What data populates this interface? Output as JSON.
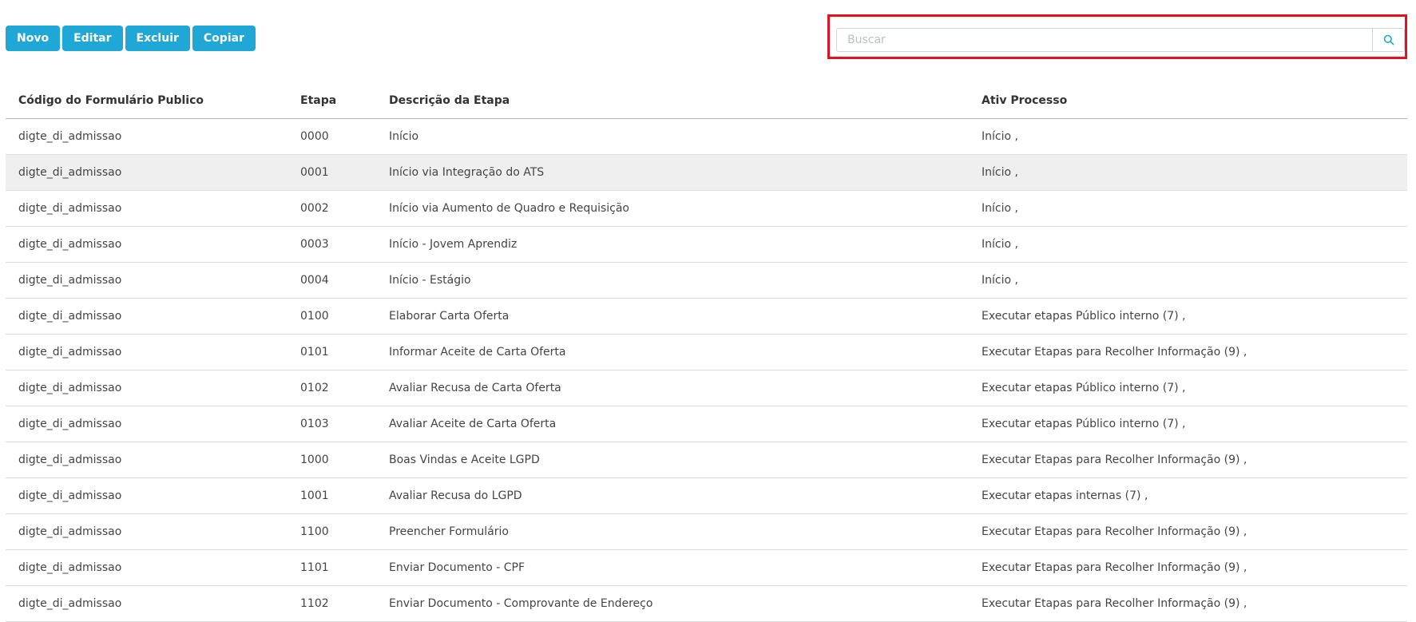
{
  "toolbar": {
    "new_label": "Novo",
    "edit_label": "Editar",
    "delete_label": "Excluir",
    "copy_label": "Copiar"
  },
  "search": {
    "placeholder": "Buscar",
    "value": "",
    "icon": "search-icon"
  },
  "colors": {
    "accent": "#1fa7d6",
    "highlight_box": "#e3101e",
    "selected_row": "#efefef"
  },
  "table": {
    "columns": [
      "Código do Formulário Publico",
      "Etapa",
      "Descrição da Etapa",
      "Ativ Processo"
    ],
    "rows": [
      {
        "codigo": "digte_di_admissao",
        "etapa": "0000",
        "descricao": "Início",
        "ativ": "Início ,"
      },
      {
        "codigo": "digte_di_admissao",
        "etapa": "0001",
        "descricao": "Início via Integração do ATS",
        "ativ": "Início ,"
      },
      {
        "codigo": "digte_di_admissao",
        "etapa": "0002",
        "descricao": "Início via Aumento de Quadro e Requisição",
        "ativ": "Início ,"
      },
      {
        "codigo": "digte_di_admissao",
        "etapa": "0003",
        "descricao": "Início - Jovem Aprendiz",
        "ativ": "Início ,"
      },
      {
        "codigo": "digte_di_admissao",
        "etapa": "0004",
        "descricao": "Início - Estágio",
        "ativ": "Início ,"
      },
      {
        "codigo": "digte_di_admissao",
        "etapa": "0100",
        "descricao": "Elaborar Carta Oferta",
        "ativ": "Executar etapas Público interno (7) ,"
      },
      {
        "codigo": "digte_di_admissao",
        "etapa": "0101",
        "descricao": "Informar Aceite de Carta Oferta",
        "ativ": "Executar Etapas para Recolher Informação (9) ,"
      },
      {
        "codigo": "digte_di_admissao",
        "etapa": "0102",
        "descricao": "Avaliar Recusa de Carta Oferta",
        "ativ": "Executar etapas Público interno (7) ,"
      },
      {
        "codigo": "digte_di_admissao",
        "etapa": "0103",
        "descricao": "Avaliar Aceite de Carta Oferta",
        "ativ": "Executar etapas Público interno (7) ,"
      },
      {
        "codigo": "digte_di_admissao",
        "etapa": "1000",
        "descricao": "Boas Vindas e Aceite LGPD",
        "ativ": "Executar Etapas para Recolher Informação (9) ,"
      },
      {
        "codigo": "digte_di_admissao",
        "etapa": "1001",
        "descricao": "Avaliar Recusa do LGPD",
        "ativ": "Executar etapas internas (7) ,"
      },
      {
        "codigo": "digte_di_admissao",
        "etapa": "1100",
        "descricao": "Preencher Formulário",
        "ativ": "Executar Etapas para Recolher Informação (9) ,"
      },
      {
        "codigo": "digte_di_admissao",
        "etapa": "1101",
        "descricao": "Enviar Documento - CPF",
        "ativ": "Executar Etapas para Recolher Informação (9) ,"
      },
      {
        "codigo": "digte_di_admissao",
        "etapa": "1102",
        "descricao": "Enviar Documento - Comprovante de Endereço",
        "ativ": "Executar Etapas para Recolher Informação (9) ,"
      }
    ]
  }
}
